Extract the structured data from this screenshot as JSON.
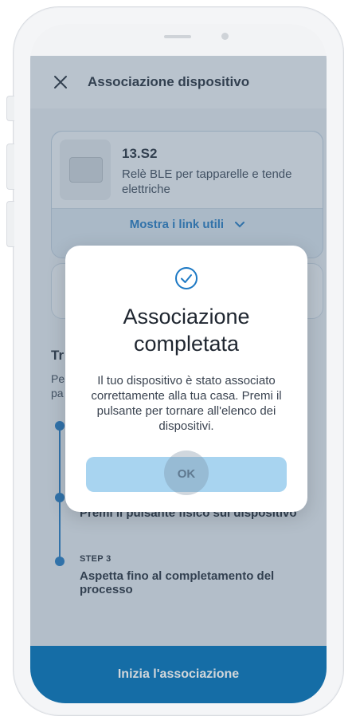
{
  "appbar": {
    "title": "Associazione dispositivo"
  },
  "device": {
    "name": "13.S2",
    "description": "Relè BLE per tapparelle e tende elettriche",
    "links_label": "Mostra i link utili"
  },
  "section": {
    "title": "Tr",
    "desc_line1": "Pe",
    "desc_line2": "pa"
  },
  "steps": [
    {
      "label": "",
      "text": ""
    },
    {
      "label": "",
      "text": "Premi il pulsante fisico sul dispositivo"
    },
    {
      "label": "STEP 3",
      "text": "Aspetta fino al completamento del processo"
    }
  ],
  "bottom_button": {
    "label": "Inizia l'associazione"
  },
  "modal": {
    "title_line1": "Associazione",
    "title_line2": "completata",
    "body": "Il tuo dispositivo è stato associato correttamente alla tua casa. Premi il pulsante per tornare all'elenco dei dispositivi.",
    "ok_label": "OK"
  },
  "colors": {
    "accent": "#1a7fc0",
    "link": "#1d79c4",
    "ok_button": "#a8d4f0"
  },
  "icons": {
    "close": "close-icon",
    "chevron": "chevron-down-icon",
    "check": "check-circle-icon"
  }
}
